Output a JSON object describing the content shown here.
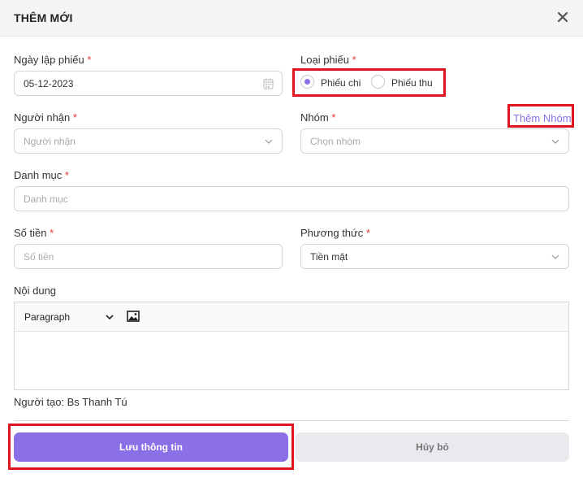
{
  "dialog": {
    "title": "THÊM MỚI"
  },
  "form": {
    "date": {
      "label": "Ngày lập phiếu",
      "required": "*",
      "value": "05-12-2023"
    },
    "voucher_type": {
      "label": "Loại phiếu",
      "required": "*",
      "options": [
        {
          "label": "Phiếu chi",
          "checked": true
        },
        {
          "label": "Phiếu thu",
          "checked": false
        }
      ]
    },
    "receiver": {
      "label": "Người nhận",
      "required": "*",
      "placeholder": "Người nhận"
    },
    "group": {
      "label": "Nhóm",
      "required": "*",
      "placeholder": "Chọn nhóm",
      "add_link": "Thêm Nhóm"
    },
    "category": {
      "label": "Danh mục",
      "required": "*",
      "placeholder": "Danh mục"
    },
    "amount": {
      "label": "Số tiền",
      "required": "*",
      "placeholder": "Số tiền"
    },
    "method": {
      "label": "Phương thức",
      "required": "*",
      "value": "Tiền mặt"
    },
    "content": {
      "label": "Nội dung",
      "format": "Paragraph"
    },
    "creator": "Người tạo: Bs Thanh Tú"
  },
  "actions": {
    "save": "Lưu thông tin",
    "cancel": "Hủy bỏ"
  },
  "colors": {
    "accent": "#8b6fe6",
    "required": "#e53935",
    "highlight": "#e0141e"
  }
}
